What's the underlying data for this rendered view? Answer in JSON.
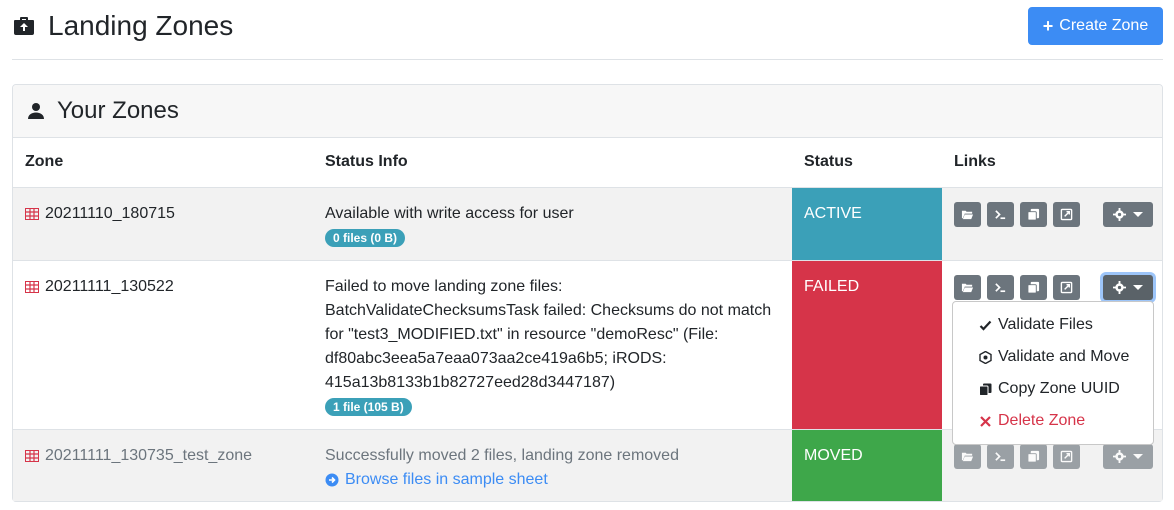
{
  "page": {
    "title": "Landing Zones",
    "create_button": "Create Zone"
  },
  "card": {
    "title": "Your Zones"
  },
  "table": {
    "headers": [
      "Zone",
      "Status Info",
      "Status",
      "Links"
    ],
    "rows": [
      {
        "zone": "20211110_180715",
        "status_info": "Available with write access for user",
        "badge": "0 files (0 B)",
        "status": "ACTIVE"
      },
      {
        "zone": "20211111_130522",
        "status_info_lines": [
          "Failed to move landing zone files:",
          "BatchValidateChecksumsTask failed: Checksums do not match",
          "for \"test3_MODIFIED.txt\" in resource \"demoResc\" (File:",
          "df80abc3eea5a7eaa073aa2ce419a6b5; iRODS:",
          "415a13b8133b1b82727eed28d3447187)"
        ],
        "badge": "1 file (105 B)",
        "status": "FAILED"
      },
      {
        "zone": "20211111_130735_test_zone",
        "status_info": "Successfully moved 2 files, landing zone removed",
        "link": "Browse files in sample sheet",
        "status": "MOVED"
      }
    ]
  },
  "dropdown": {
    "items": [
      "Validate Files",
      "Validate and Move",
      "Copy Zone UUID",
      "Delete Zone"
    ]
  },
  "colors": {
    "primary": "#3c8cf4",
    "active": "#3ba0b8",
    "failed": "#d63449",
    "moved": "#3ea74a",
    "secondary": "#6c757d"
  },
  "icons": [
    "briefcase-upload-icon",
    "plus-icon",
    "user-icon",
    "table-icon",
    "folder-open-icon",
    "terminal-icon",
    "clipboard-icon",
    "external-link-icon",
    "gear-icon",
    "check-icon",
    "hexagon-check-icon",
    "times-icon",
    "arrow-circle-right-icon"
  ]
}
